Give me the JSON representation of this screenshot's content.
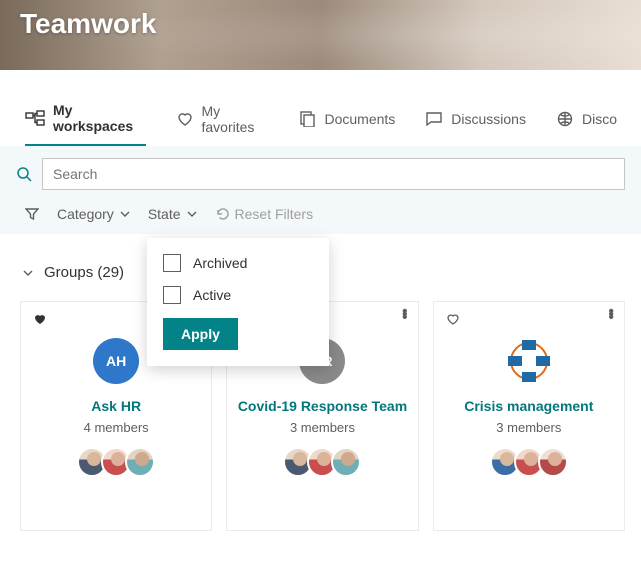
{
  "hero": {
    "title": "Teamwork"
  },
  "tabs": {
    "my_workspaces": "My workspaces",
    "my_favorites": "My favorites",
    "documents": "Documents",
    "discussions": "Discussions",
    "discover": "Disco"
  },
  "search": {
    "placeholder": "Search"
  },
  "filter_bar": {
    "category_label": "Category",
    "state_label": "State",
    "reset_label": "Reset Filters"
  },
  "state_dropdown": {
    "option_archived": "Archived",
    "option_active": "Active",
    "apply_label": "Apply"
  },
  "section": {
    "groups_label": "Groups (29)"
  },
  "cards": [
    {
      "title": "Ask HR",
      "subtitle": "4 members",
      "badge_text": "AH",
      "badge_color": "#2f77c9",
      "favorite": true
    },
    {
      "title": "Covid-19 Response Team",
      "subtitle": "3 members",
      "badge_text": "CR",
      "badge_color": "#8a8a8a",
      "favorite": false
    },
    {
      "title": "Crisis management",
      "subtitle": "3 members",
      "badge_text": "",
      "badge_color": "",
      "favorite": false,
      "logo": "crisis"
    }
  ]
}
